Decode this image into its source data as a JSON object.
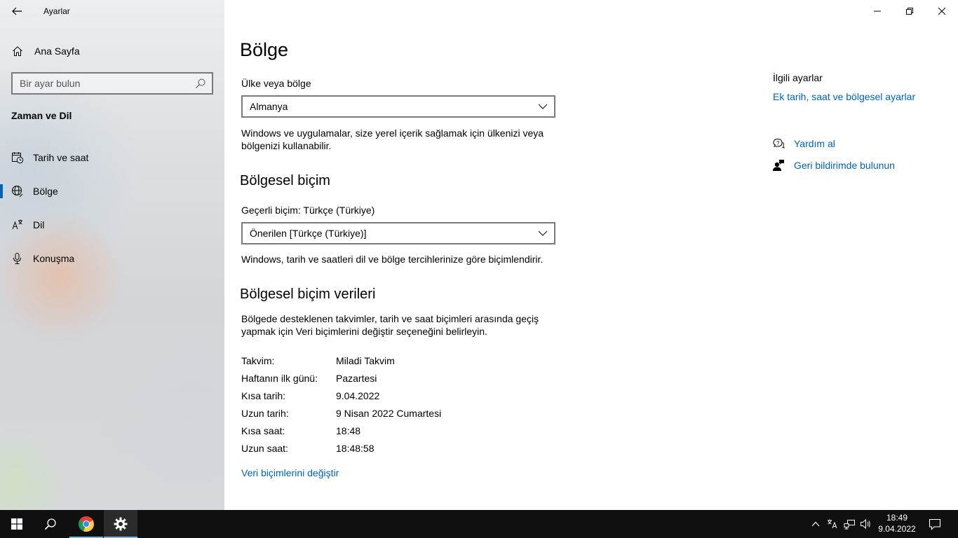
{
  "window": {
    "app_title": "Ayarlar"
  },
  "sidebar": {
    "home_label": "Ana Sayfa",
    "search": {
      "placeholder": "Bir ayar bulun",
      "value": ""
    },
    "section_title": "Zaman ve Dil",
    "items": [
      {
        "label": "Tarih ve saat",
        "icon": "calendar-clock-icon",
        "selected": false
      },
      {
        "label": "Bölge",
        "icon": "globe-icon",
        "selected": true
      },
      {
        "label": "Dil",
        "icon": "language-icon",
        "selected": false
      },
      {
        "label": "Konuşma",
        "icon": "microphone-icon",
        "selected": false
      }
    ]
  },
  "main": {
    "title": "Bölge",
    "country": {
      "label": "Ülke veya bölge",
      "value": "Almanya",
      "description": "Windows ve uygulamalar, size yerel içerik sağlamak için ülkenizi veya bölgenizi kullanabilir."
    },
    "regional_format": {
      "heading": "Bölgesel biçim",
      "current_label": "Geçerli biçim: Türkçe (Türkiye)",
      "value": "Önerilen [Türkçe (Türkiye)]",
      "description": "Windows, tarih ve saatleri dil ve bölge tercihlerinize göre biçimlendirir."
    },
    "format_data": {
      "heading": "Bölgesel biçim verileri",
      "description": "Bölgede desteklenen takvimler, tarih ve saat biçimleri arasında geçiş yapmak için Veri biçimlerini değiştir seçeneğini belirleyin.",
      "rows": [
        {
          "key": "Takvim:",
          "value": "Miladi Takvim"
        },
        {
          "key": "Haftanın ilk günü:",
          "value": "Pazartesi"
        },
        {
          "key": "Kısa tarih:",
          "value": "9.04.2022"
        },
        {
          "key": "Uzun tarih:",
          "value": "9 Nisan 2022 Cumartesi"
        },
        {
          "key": "Kısa saat:",
          "value": "18:48"
        },
        {
          "key": "Uzun saat:",
          "value": "18:48:58"
        }
      ],
      "change_link": "Veri biçimlerini değiştir"
    },
    "related": {
      "title": "İlgili ayarlar",
      "link": "Ek tarih, saat ve bölgesel ayarlar",
      "help": "Yardım al",
      "feedback": "Geri bildirimde bulunun"
    }
  },
  "taskbar": {
    "time": "18:49",
    "date": "9.04.2022",
    "accent": "#76b9ed"
  }
}
